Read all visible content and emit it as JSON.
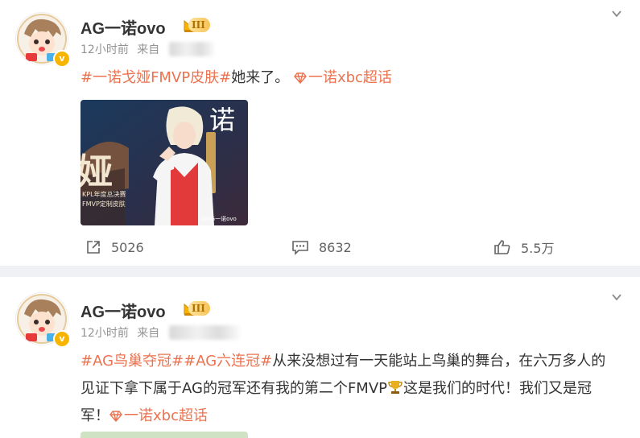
{
  "posts": [
    {
      "username": "AG一诺ovo",
      "vip_level": "III",
      "time": "12小时前",
      "source_prefix": "来自",
      "hashtag": "#一诺戈娅FMVP皮肤#",
      "text": "她来了。",
      "supertopic": "一诺xbc超话",
      "image": {
        "left_char": "娅",
        "caption_line1": "KPL年度总决赛",
        "caption_line2": "FMVP定制皮肤",
        "watermark": "@AG一诺ovo",
        "signature": "诺"
      },
      "actions": {
        "repost": "5026",
        "comment": "8632",
        "like": "5.5万"
      }
    },
    {
      "username": "AG一诺ovo",
      "vip_level": "III",
      "time": "12小时前",
      "source_prefix": "来自",
      "hashtag1": "#AG鸟巢夺冠#",
      "hashtag2": "#AG六连冠#",
      "text_line1": "从来没想过有一天能站上鸟巢的舞台，在六万多人的",
      "text_line2_a": "见证下拿下属于AG的冠军还有我的第二个FMVP",
      "text_line2_b": "这是我们的时代！我们又是冠",
      "text_line3": "军！",
      "supertopic": "一诺xbc超话"
    }
  ],
  "icons": {
    "repost": "repost-icon",
    "comment": "comment-icon",
    "like": "like-icon",
    "more": "chevron-down-icon",
    "trophy": "trophy-icon",
    "supertopic": "diamond-icon"
  },
  "colors": {
    "accent": "#eb7350",
    "text": "#333333",
    "meta": "#939393",
    "vip": "#f7b500",
    "separator": "#f0f1f4"
  }
}
